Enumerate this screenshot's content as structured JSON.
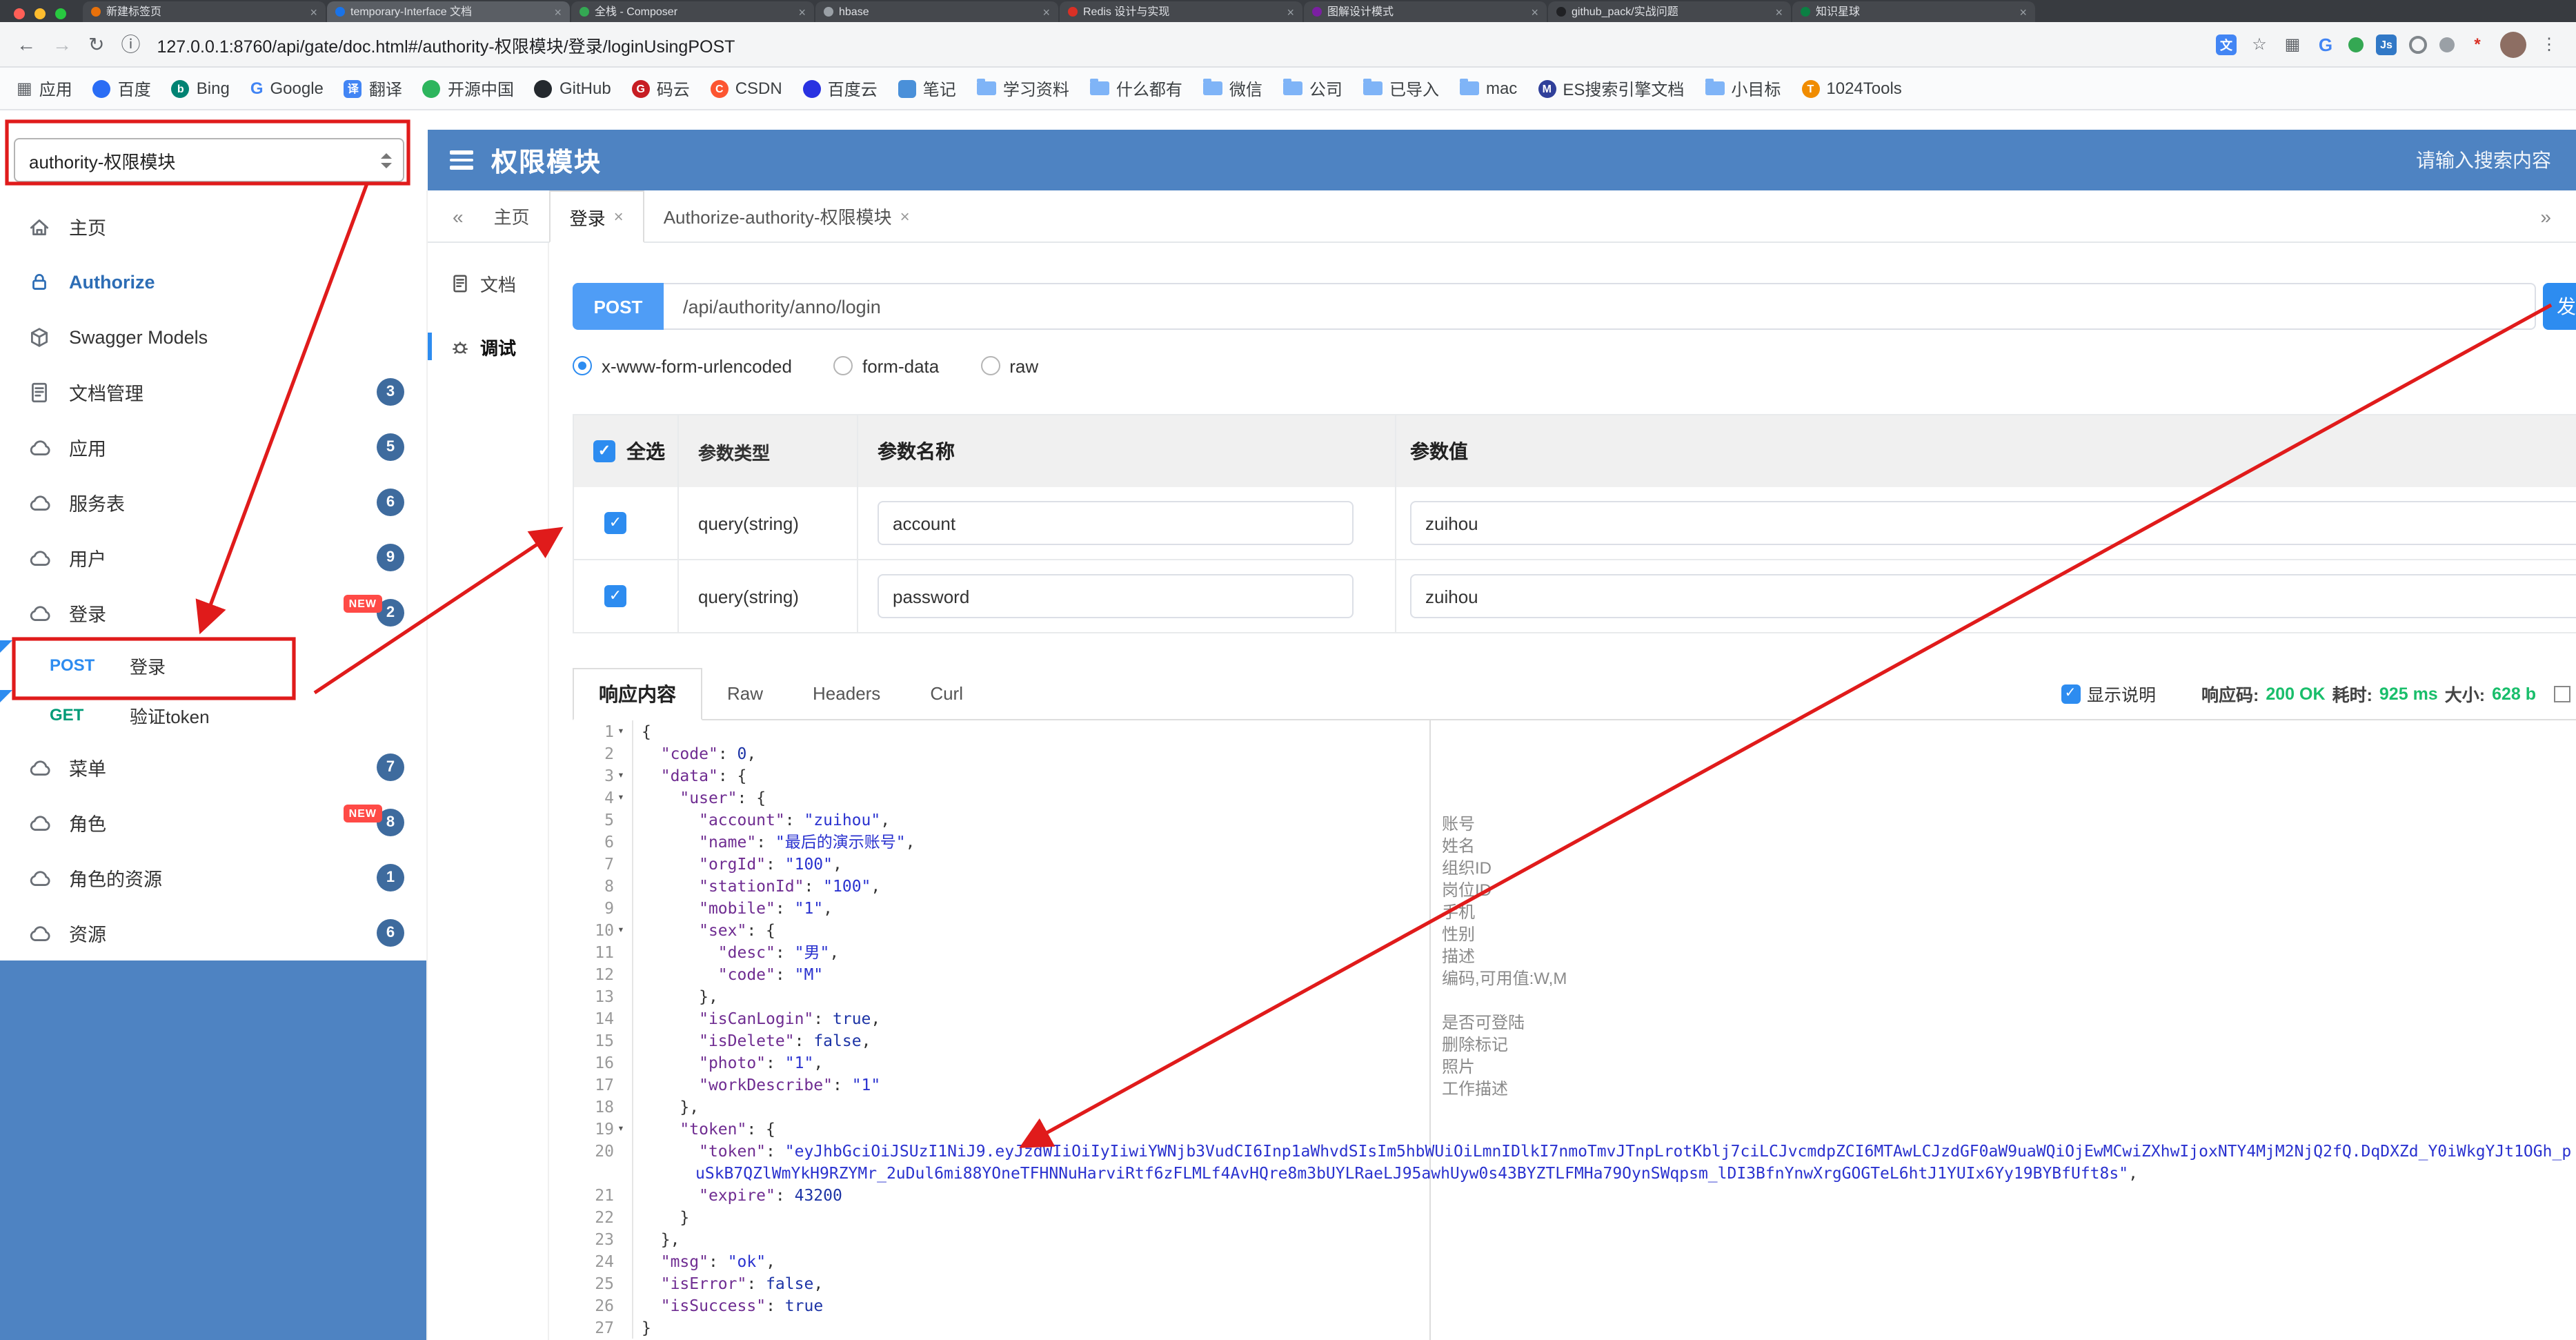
{
  "browser": {
    "tabs": [
      {
        "title": "新建标签页"
      },
      {
        "title": "temporary-Interface 文档"
      },
      {
        "title": "全栈 - Composer"
      },
      {
        "title": "hbase"
      },
      {
        "title": "Redis 设计与实现"
      },
      {
        "title": "图解设计模式"
      },
      {
        "title": "github_pack/实战问题"
      },
      {
        "title": "知识星球"
      }
    ],
    "url": "127.0.0.1:8760/api/gate/doc.html#/authority-权限模块/登录/loginUsingPOST",
    "bookmarks": [
      {
        "icon": "grid",
        "label": "应用"
      },
      {
        "icon": "blue",
        "label": "百度"
      },
      {
        "icon": "bing",
        "label": "Bing"
      },
      {
        "icon": "google",
        "label": "Google"
      },
      {
        "icon": "translate",
        "label": "翻译"
      },
      {
        "icon": "osc",
        "label": "开源中国"
      },
      {
        "icon": "github",
        "label": "GitHub"
      },
      {
        "icon": "gitee",
        "label": "码云"
      },
      {
        "icon": "csdn",
        "label": "CSDN"
      },
      {
        "icon": "cloud",
        "label": "百度云"
      },
      {
        "icon": "note",
        "label": "笔记"
      },
      {
        "icon": "folder",
        "label": "学习资料"
      },
      {
        "icon": "folder",
        "label": "什么都有"
      },
      {
        "icon": "folder",
        "label": "微信"
      },
      {
        "icon": "folder",
        "label": "公司"
      },
      {
        "icon": "folder",
        "label": "已导入"
      },
      {
        "icon": "folder",
        "label": "mac"
      },
      {
        "icon": "md",
        "label": "ES搜索引擎文档"
      },
      {
        "icon": "folder",
        "label": "小目标"
      },
      {
        "icon": "tools",
        "label": "1024Tools"
      }
    ]
  },
  "header": {
    "group_select": "authority-权限模块",
    "title": "权限模块",
    "search_placeholder": "请输入搜索内容"
  },
  "sidebar": {
    "items": [
      {
        "icon": "home",
        "label": "主页"
      },
      {
        "icon": "lock",
        "label": "Authorize",
        "accent": true
      },
      {
        "icon": "cube",
        "label": "Swagger Models"
      },
      {
        "icon": "doc",
        "label": "文档管理",
        "badge": "3"
      },
      {
        "icon": "cloud",
        "label": "应用",
        "badge": "5"
      },
      {
        "icon": "cloud",
        "label": "服务表",
        "badge": "6"
      },
      {
        "icon": "cloud",
        "label": "用户",
        "badge": "9"
      },
      {
        "icon": "cloud",
        "label": "登录",
        "badge": "2",
        "new": true
      },
      {
        "child": true,
        "method": "POST",
        "label": "登录",
        "selected": true
      },
      {
        "child": true,
        "method": "GET",
        "label": "验证token"
      },
      {
        "icon": "cloud",
        "label": "菜单",
        "badge": "7"
      },
      {
        "icon": "cloud",
        "label": "角色",
        "badge": "8",
        "new": true
      },
      {
        "icon": "cloud",
        "label": "角色的资源",
        "badge": "1"
      },
      {
        "icon": "cloud",
        "label": "资源",
        "badge": "6"
      }
    ]
  },
  "main": {
    "tabs": [
      {
        "label": "主页"
      },
      {
        "label": "登录",
        "closable": true,
        "active": true
      },
      {
        "label": "Authorize-authority-权限模块",
        "closable": true
      }
    ],
    "rail": [
      {
        "icon": "doc",
        "label": "文档"
      },
      {
        "icon": "bug",
        "label": "调试",
        "active": true
      }
    ]
  },
  "request": {
    "method": "POST",
    "path": "/api/authority/anno/login",
    "send_label": "发送",
    "content_types": [
      "x-www-form-urlencoded",
      "form-data",
      "raw"
    ],
    "selected_content_type": "x-www-form-urlencoded"
  },
  "params_table": {
    "select_all_label": "全选",
    "headers": [
      "参数类型",
      "参数名称",
      "参数值"
    ],
    "rows": [
      {
        "checked": true,
        "type": "query(string)",
        "name": "account",
        "value": "zuihou"
      },
      {
        "checked": true,
        "type": "query(string)",
        "name": "password",
        "value": "zuihou"
      }
    ]
  },
  "response": {
    "tabs": [
      "响应内容",
      "Raw",
      "Headers",
      "Curl"
    ],
    "active_tab": "响应内容",
    "show_desc_label": "显示说明",
    "meta": [
      {
        "label": "响应码:",
        "value": "200 OK"
      },
      {
        "label": "耗时:",
        "value": "925 ms"
      },
      {
        "label": "大小:",
        "value": "628 b"
      }
    ]
  },
  "code": {
    "fold_lines": [
      1,
      3,
      4,
      10,
      19
    ],
    "lines": [
      [
        [
          "pl",
          "{"
        ]
      ],
      [
        [
          "pl",
          "  "
        ],
        [
          "k",
          "code"
        ],
        [
          "pl",
          ": "
        ],
        [
          "n",
          "0"
        ],
        [
          "pl",
          ","
        ]
      ],
      [
        [
          "pl",
          "  "
        ],
        [
          "k",
          "data"
        ],
        [
          "pl",
          ": {"
        ]
      ],
      [
        [
          "pl",
          "    "
        ],
        [
          "k",
          "user"
        ],
        [
          "pl",
          ": {"
        ]
      ],
      [
        [
          "pl",
          "      "
        ],
        [
          "k",
          "account"
        ],
        [
          "pl",
          ": "
        ],
        [
          "s",
          "zuihou"
        ],
        [
          "pl",
          ","
        ]
      ],
      [
        [
          "pl",
          "      "
        ],
        [
          "k",
          "name"
        ],
        [
          "pl",
          ": "
        ],
        [
          "s",
          "最后的演示账号"
        ],
        [
          "pl",
          ","
        ]
      ],
      [
        [
          "pl",
          "      "
        ],
        [
          "k",
          "orgId"
        ],
        [
          "pl",
          ": "
        ],
        [
          "s",
          "100"
        ],
        [
          "pl",
          ","
        ]
      ],
      [
        [
          "pl",
          "      "
        ],
        [
          "k",
          "stationId"
        ],
        [
          "pl",
          ": "
        ],
        [
          "s",
          "100"
        ],
        [
          "pl",
          ","
        ]
      ],
      [
        [
          "pl",
          "      "
        ],
        [
          "k",
          "mobile"
        ],
        [
          "pl",
          ": "
        ],
        [
          "s",
          "1"
        ],
        [
          "pl",
          ","
        ]
      ],
      [
        [
          "pl",
          "      "
        ],
        [
          "k",
          "sex"
        ],
        [
          "pl",
          ": {"
        ]
      ],
      [
        [
          "pl",
          "        "
        ],
        [
          "k",
          "desc"
        ],
        [
          "pl",
          ": "
        ],
        [
          "s",
          "男"
        ],
        [
          "pl",
          ","
        ]
      ],
      [
        [
          "pl",
          "        "
        ],
        [
          "k",
          "code"
        ],
        [
          "pl",
          ": "
        ],
        [
          "s",
          "M"
        ]
      ],
      [
        [
          "pl",
          "      },"
        ]
      ],
      [
        [
          "pl",
          "      "
        ],
        [
          "k",
          "isCanLogin"
        ],
        [
          "pl",
          ": "
        ],
        [
          "b",
          "true"
        ],
        [
          "pl",
          ","
        ]
      ],
      [
        [
          "pl",
          "      "
        ],
        [
          "k",
          "isDelete"
        ],
        [
          "pl",
          ": "
        ],
        [
          "b",
          "false"
        ],
        [
          "pl",
          ","
        ]
      ],
      [
        [
          "pl",
          "      "
        ],
        [
          "k",
          "photo"
        ],
        [
          "pl",
          ": "
        ],
        [
          "s",
          "1"
        ],
        [
          "pl",
          ","
        ]
      ],
      [
        [
          "pl",
          "      "
        ],
        [
          "k",
          "workDescribe"
        ],
        [
          "pl",
          ": "
        ],
        [
          "s",
          "1"
        ]
      ],
      [
        [
          "pl",
          "    },"
        ]
      ],
      [
        [
          "pl",
          "    "
        ],
        [
          "k",
          "token"
        ],
        [
          "pl",
          ": {"
        ]
      ],
      [
        [
          "pl",
          "      "
        ],
        [
          "k",
          "token"
        ],
        [
          "pl",
          ": "
        ],
        [
          "s",
          "eyJhbGciOiJSUzI1NiJ9.eyJzdWIiOiIyIiwiYWNjb3VudCI6Inp1aWhvdSIsIm5hbWUiOiLmnIDlkI7nmoTmvJTnpLrotKblj7ciLCJvcmdpZCI6MTAwLCJzdGF0aW9uaWQiOjEwMCwiZXhwIjoxNTY4MjM2NjQ2fQ.DqDXZd_Y0iWkgYJt1OGh_puSkB7QZlWmYkH9RZYMr_2uDul6mi88YOneTFHNNuHarviRtf6zFLMLf4AvHQre8m3bUYLRaeLJ95awhUyw0s43BYZTLFMHa79OynSWqpsm_lDI3BfnYnwXrgGOGTeL6htJ1YUIx6Yy19BYBfUft8s"
        ],
        [
          "pl",
          ","
        ]
      ],
      [
        [
          "pl",
          "      "
        ],
        [
          "k",
          "expire"
        ],
        [
          "pl",
          ": "
        ],
        [
          "n",
          "43200"
        ]
      ],
      [
        [
          "pl",
          "    }"
        ]
      ],
      [
        [
          "pl",
          "  },"
        ]
      ],
      [
        [
          "pl",
          "  "
        ],
        [
          "k",
          "msg"
        ],
        [
          "pl",
          ": "
        ],
        [
          "s",
          "ok"
        ],
        [
          "pl",
          ","
        ]
      ],
      [
        [
          "pl",
          "  "
        ],
        [
          "k",
          "isError"
        ],
        [
          "pl",
          ": "
        ],
        [
          "b",
          "false"
        ],
        [
          "pl",
          ","
        ]
      ],
      [
        [
          "pl",
          "  "
        ],
        [
          "k",
          "isSuccess"
        ],
        [
          "pl",
          ": "
        ],
        [
          "b",
          "true"
        ]
      ],
      [
        [
          "pl",
          "}"
        ]
      ]
    ],
    "annotations": {
      "5": "账号",
      "6": "姓名",
      "7": "组织ID",
      "8": "岗位ID",
      "9": "手机",
      "10": "性别",
      "11": "描述",
      "12": "编码,可用值:W,M",
      "14": "是否可登陆",
      "15": "删除标记",
      "16": "照片",
      "17": "工作描述"
    }
  },
  "colors": {
    "accent_blue": "#2d8cf0",
    "header_blue": "#4e83c2",
    "success_green": "#19be6b",
    "annotation_red": "#e01b1b",
    "badge_navy": "#3e6b9e",
    "method_get_green": "#009b77"
  }
}
